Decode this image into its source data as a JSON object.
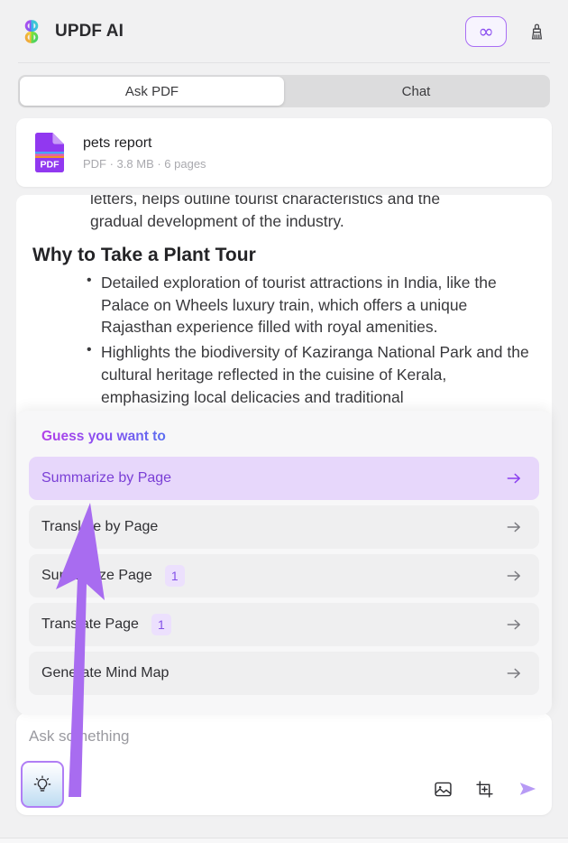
{
  "header": {
    "app_title": "UPDF AI",
    "logo_icon": "clover-logo-icon",
    "unlimited_icon": "infinity-icon",
    "clear_icon": "broom-icon",
    "accent_color": "#8b4ef0"
  },
  "tabs": [
    {
      "label": "Ask PDF",
      "active": true
    },
    {
      "label": "Chat",
      "active": false
    }
  ],
  "file_card": {
    "icon": "pdf-file-icon",
    "name": "pets report",
    "meta": "PDF · 3.8 MB · 6 pages"
  },
  "document": {
    "line1": "letters, helps outline tourist characteristics and the",
    "line2": "gradual development of the industry.",
    "heading": "Why to Take a Plant Tour",
    "bullets": [
      "Detailed exploration of tourist attractions in India, like the Palace on Wheels luxury train, which offers a unique Rajasthan experience filled with royal amenities.",
      "Highlights the biodiversity of Kaziranga National Park and the cultural heritage reflected in the cuisine of Kerala, emphasizing local delicacies and traditional"
    ]
  },
  "suggestions": {
    "title": "Guess you want to",
    "items": [
      {
        "label": "Summarize by Page",
        "badge": null,
        "highlighted": true
      },
      {
        "label": "Translate by Page",
        "badge": null,
        "highlighted": false
      },
      {
        "label": "Summarize Page",
        "badge": "1",
        "highlighted": false
      },
      {
        "label": "Translate Page",
        "badge": "1",
        "highlighted": false
      },
      {
        "label": "Generate Mind Map",
        "badge": null,
        "highlighted": false
      }
    ],
    "arrow_icon": "arrow-right-icon",
    "highlight_color": "#e7d7fb"
  },
  "composer": {
    "placeholder": "Ask something",
    "prompt_icon": "lightbulb-icon",
    "image_icon": "image-icon",
    "snapshot_icon": "snapshot-crop-icon",
    "send_icon": "send-arrow-icon"
  },
  "annotation": {
    "pointer_icon": "arrow-pointer-annotation",
    "color": "#a86cf0"
  }
}
